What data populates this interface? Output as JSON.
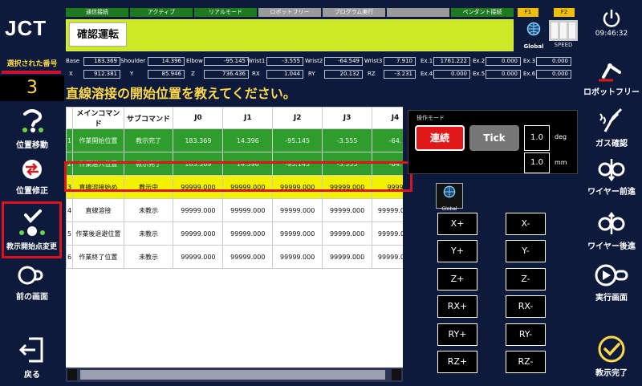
{
  "app": {
    "logo": "JCT"
  },
  "sidebar_left": {
    "selected_label": "選択された番号",
    "selected_number": "3",
    "items": [
      {
        "label": "位置移動",
        "icon": "move-position-icon"
      },
      {
        "label": "位置修正",
        "icon": "position-correct-icon"
      },
      {
        "label": "教示開始点変更",
        "icon": "teach-start-point-icon"
      },
      {
        "label": "前の画面",
        "icon": "previous-screen-icon"
      },
      {
        "label": "戻る",
        "icon": "back-icon"
      }
    ]
  },
  "status_tabs": [
    "通信接続",
    "アクティブ",
    "リアルモード",
    "ロボットフリー",
    "プログラム実行",
    "",
    "ペンダント接続"
  ],
  "fkeys": [
    "F1",
    "F2"
  ],
  "header": {
    "title": "確認運転",
    "global_label": "Global",
    "speed_label": "SPEED",
    "time": "09:46:32"
  },
  "coords_row1": [
    {
      "label": "Base",
      "value": "183.369"
    },
    {
      "label": "Shoulder",
      "value": "14.396"
    },
    {
      "label": "Elbow",
      "value": "-95.145"
    },
    {
      "label": "Wrist1",
      "value": "-3.555"
    },
    {
      "label": "Wrist2",
      "value": "-64.549"
    },
    {
      "label": "Wrist3",
      "value": "7.910"
    },
    {
      "label": "Ex.1",
      "value": "1761.222"
    },
    {
      "label": "Ex.2",
      "value": "0.000"
    },
    {
      "label": "Ex.3",
      "value": "0.000"
    }
  ],
  "coords_row2": [
    {
      "label": "X",
      "value": "912.381"
    },
    {
      "label": "Y",
      "value": "85.946"
    },
    {
      "label": "Z",
      "value": "736.436"
    },
    {
      "label": "RX",
      "value": "1.044"
    },
    {
      "label": "RY",
      "value": "20.132"
    },
    {
      "label": "RZ",
      "value": "-3.231"
    },
    {
      "label": "Ex.4",
      "value": "0.000"
    },
    {
      "label": "Ex.5",
      "value": "0.000"
    },
    {
      "label": "Ex.6",
      "value": "0.000"
    }
  ],
  "instruction": "直線溶接の開始位置を教えてください。",
  "table": {
    "headers": [
      "",
      "メインコマンド",
      "サブコマンド",
      "J0",
      "J1",
      "J2",
      "J3",
      "J4"
    ],
    "rows": [
      {
        "no": "1",
        "main": "作業開始位置",
        "sub": "教示完了",
        "j0": "183.369",
        "j1": "14.396",
        "j2": "-95.145",
        "j3": "-3.555",
        "j4": "-64."
      },
      {
        "no": "2",
        "main": "作業進入位置",
        "sub": "教示完了",
        "j0": "183.369",
        "j1": "14.396",
        "j2": "-95.145",
        "j3": "-3.555",
        "j4": "-64."
      },
      {
        "no": "3",
        "main": "直線溶接始め",
        "sub": "教示中",
        "j0": "99999.000",
        "j1": "99999.000",
        "j2": "99999.000",
        "j3": "99999.000",
        "j4": "9999"
      },
      {
        "no": "4",
        "main": "直線溶接",
        "sub": "未教示",
        "j0": "99999.000",
        "j1": "99999.000",
        "j2": "99999.000",
        "j3": "99999.000",
        "j4": "99999.000"
      },
      {
        "no": "5",
        "main": "作業後退避位置",
        "sub": "未教示",
        "j0": "99999.000",
        "j1": "99999.000",
        "j2": "99999.000",
        "j3": "99999.000",
        "j4": "99999.000"
      },
      {
        "no": "6",
        "main": "作業終了位置",
        "sub": "未教示",
        "j0": "99999.000",
        "j1": "99999.000",
        "j2": "99999.000",
        "j3": "99999.000",
        "j4": "99999.000"
      }
    ]
  },
  "operation": {
    "title": "操作モード",
    "continuous": "連続",
    "tick": "Tick",
    "deg_value": "1.0",
    "deg_unit": "deg",
    "mm_value": "1.0",
    "mm_unit": "mm",
    "global_label": "Global"
  },
  "jog_buttons": [
    [
      "X+",
      "X-"
    ],
    [
      "Y+",
      "Y-"
    ],
    [
      "Z+",
      "Z-"
    ],
    [
      "RX+",
      "RX-"
    ],
    [
      "RY+",
      "RY-"
    ],
    [
      "RZ+",
      "RZ-"
    ]
  ],
  "sidebar_right": {
    "items": [
      {
        "label": "ロボットフリー",
        "icon": "robot-free-icon"
      },
      {
        "label": "ガス確認",
        "icon": "gas-check-icon"
      },
      {
        "label": "ワイヤー前進",
        "icon": "wire-forward-icon"
      },
      {
        "label": "ワイヤー後進",
        "icon": "wire-backward-icon"
      },
      {
        "label": "実行画面",
        "icon": "run-screen-icon"
      },
      {
        "label": "教示完了",
        "icon": "teach-complete-icon"
      }
    ]
  },
  "colors": {
    "background": "#0d1a3c",
    "accent_yellow": "#ffd84a",
    "highlight_red": "#e0101e",
    "ok_green": "#2e9d2e",
    "selected_row": "#f2f200"
  }
}
